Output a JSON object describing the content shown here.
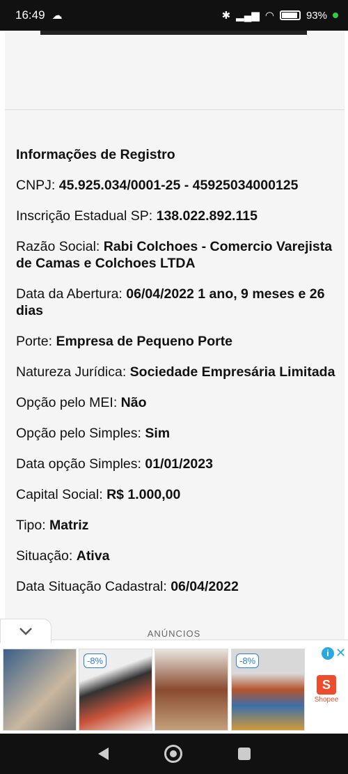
{
  "status_bar": {
    "time": "16:49",
    "battery": "93%"
  },
  "section": {
    "title": "Informações de Registro",
    "rows": [
      {
        "label": "CNPJ: ",
        "value": "45.925.034/0001-25 - 45925034000125"
      },
      {
        "label": "Inscrição Estadual SP: ",
        "value": "138.022.892.115"
      },
      {
        "label": "Razão Social: ",
        "value": "Rabi Colchoes - Comercio Varejista de Camas e Colchoes LTDA"
      },
      {
        "label": "Data da Abertura: ",
        "value": "06/04/2022 1 ano, 9 meses e 26 dias"
      },
      {
        "label": "Porte: ",
        "value": "Empresa de Pequeno Porte"
      },
      {
        "label": "Natureza Jurídica: ",
        "value": "Sociedade Empresária Limitada"
      },
      {
        "label": "Opção pelo MEI: ",
        "value": "Não"
      },
      {
        "label": "Opção pelo Simples: ",
        "value": "Sim"
      },
      {
        "label": "Data opção Simples: ",
        "value": "01/01/2023"
      },
      {
        "label": "Capital Social: ",
        "value": "R$ 1.000,00"
      },
      {
        "label": "Tipo: ",
        "value": "Matriz"
      },
      {
        "label": "Situação: ",
        "value": "Ativa"
      },
      {
        "label": "Data Situação Cadastral: ",
        "value": "06/04/2022"
      }
    ]
  },
  "ads": {
    "label": "ANÚNCIOS",
    "badges": [
      "-8%",
      "-8%"
    ],
    "brand": "Shopee",
    "brand_letter": "S"
  }
}
